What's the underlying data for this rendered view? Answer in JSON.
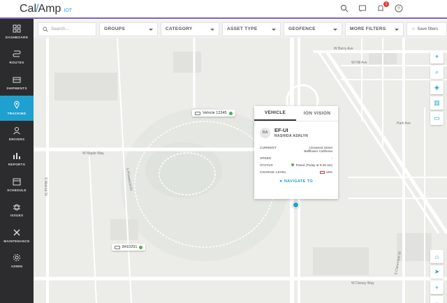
{
  "brand": {
    "part1": "Cal",
    "part2": "Amp",
    "suffix": "IOT"
  },
  "notifications": {
    "count": "1"
  },
  "nav": [
    {
      "label": "DASHBOARD",
      "icon": "dashboard-icon"
    },
    {
      "label": "ROUTES",
      "icon": "routes-icon"
    },
    {
      "label": "SHIPMENTS",
      "icon": "shipments-icon"
    },
    {
      "label": "TRACKING",
      "icon": "tracking-icon",
      "active": true
    },
    {
      "label": "DRIVERS",
      "icon": "drivers-icon"
    },
    {
      "label": "REPORTS",
      "icon": "reports-icon"
    },
    {
      "label": "SCHEDULE",
      "icon": "schedule-icon"
    },
    {
      "label": "ISSUES",
      "icon": "issues-icon"
    },
    {
      "label": "MAINTENANCE",
      "icon": "maintenance-icon"
    },
    {
      "label": "ADMIN",
      "icon": "admin-icon"
    }
  ],
  "filters": {
    "search_placeholder": "Search...",
    "groups": "GROUPS",
    "category": "CATEGORY",
    "asset_type": "ASSET TYPE",
    "geofence": "GEOFENCE",
    "more_filters": "MORE FILTERS",
    "save": "Save filters"
  },
  "map": {
    "vehicles": [
      {
        "label": "Vehicle 12345"
      },
      {
        "label": "8410291"
      }
    ],
    "roads": [
      "W Berry Ave",
      "W Hill Ave",
      "W Maple Way",
      "W Disney Way",
      "S Walnut St",
      "S Claremont St",
      "Park Ave",
      "S Pinewood Dr"
    ]
  },
  "popup": {
    "tab_vehicle": "VEHICLE",
    "tab_ion": "ION VISION",
    "avatar": "RA",
    "asset_name": "EF-UI",
    "driver": "RASHIDA ASHLYN",
    "current_label": "CURRENT",
    "current_value_1": "Unnamed Street",
    "current_value_2": "Bellflower California",
    "speed_label": "SPEED",
    "speed_value": "-",
    "status_label": "STATUS",
    "status_value": "Towed (Today at 6:45 am)",
    "charge_label": "CHARGE LEVEL",
    "charge_value": "19%",
    "navigate": "NAVIGATE TO"
  },
  "colors": {
    "accent": "#1fa0cf",
    "sidebar": "#2c2c2e",
    "status": "#4caf50",
    "alert": "#e53935",
    "brand_line": "#7b61c9"
  }
}
